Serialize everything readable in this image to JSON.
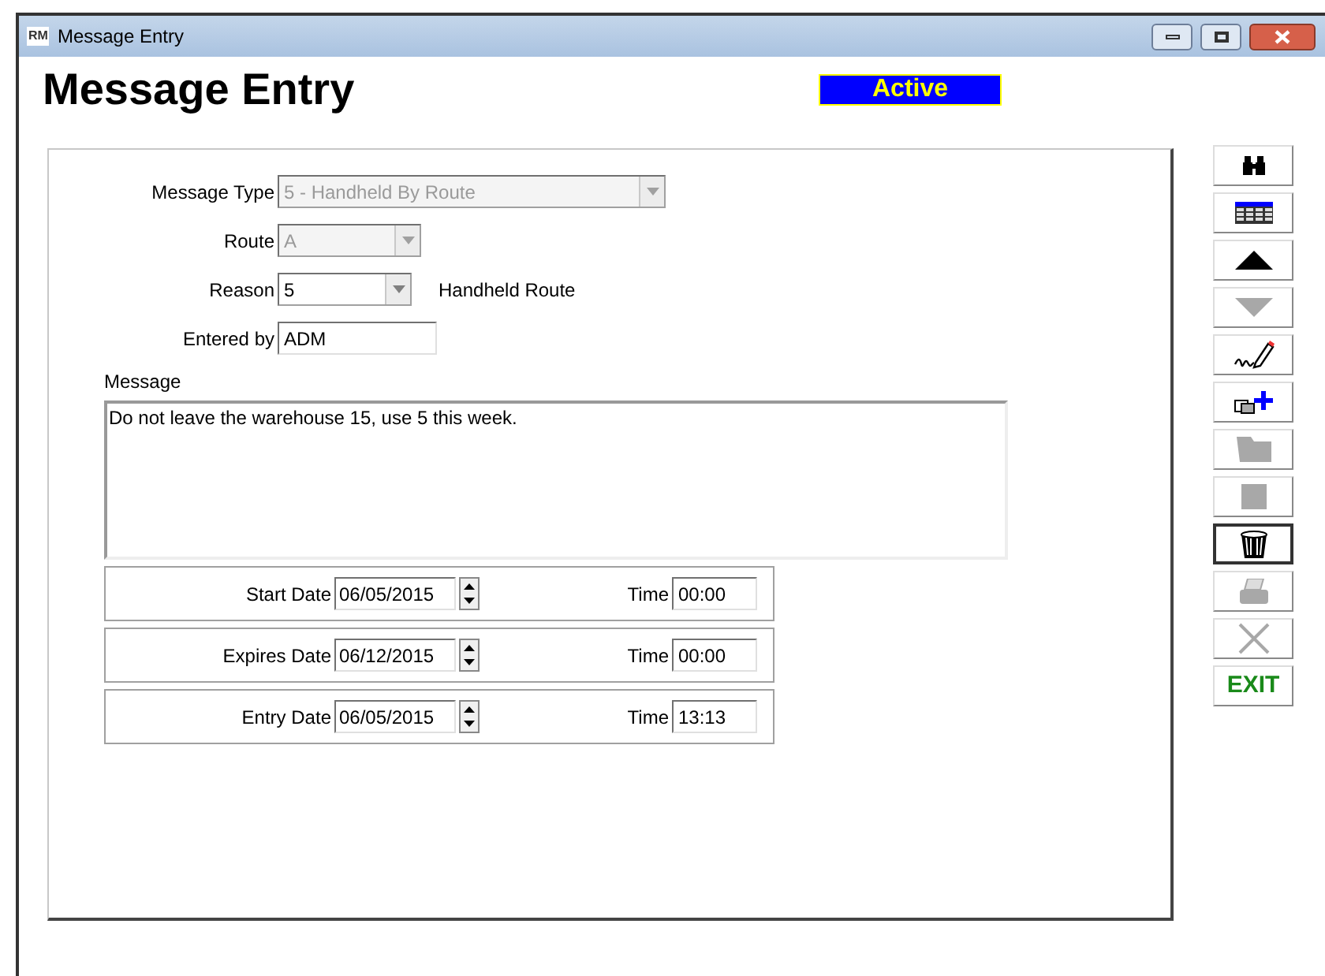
{
  "window": {
    "logo": "RM",
    "title": "Message Entry"
  },
  "heading": "Message Entry",
  "status": "Active",
  "form": {
    "message_type": {
      "label": "Message Type",
      "value": "5 - Handheld By Route",
      "disabled": true
    },
    "route": {
      "label": "Route",
      "value": "A",
      "disabled": true
    },
    "reason": {
      "label": "Reason",
      "value": "5",
      "disabled": false,
      "description": "Handheld Route"
    },
    "entered_by": {
      "label": "Entered by",
      "value": "ADM"
    },
    "message": {
      "label": "Message",
      "value": "Do not leave the warehouse 15, use 5 this week."
    }
  },
  "dates": [
    {
      "label": "Start Date",
      "date": "06/05/2015",
      "time_label": "Time",
      "time": "00:00"
    },
    {
      "label": "Expires Date",
      "date": "06/12/2015",
      "time_label": "Time",
      "time": "00:00"
    },
    {
      "label": "Entry Date",
      "date": "06/05/2015",
      "time_label": "Time",
      "time": "13:13"
    }
  ],
  "toolbar": [
    {
      "kind": "find",
      "disabled": false,
      "selected": false
    },
    {
      "kind": "grid",
      "disabled": false,
      "selected": false
    },
    {
      "kind": "up",
      "disabled": false,
      "selected": false
    },
    {
      "kind": "down",
      "disabled": true,
      "selected": false
    },
    {
      "kind": "sign",
      "disabled": false,
      "selected": false
    },
    {
      "kind": "add",
      "disabled": false,
      "selected": false
    },
    {
      "kind": "folder",
      "disabled": true,
      "selected": false
    },
    {
      "kind": "square",
      "disabled": true,
      "selected": false
    },
    {
      "kind": "trash",
      "disabled": false,
      "selected": true
    },
    {
      "kind": "print",
      "disabled": true,
      "selected": false
    },
    {
      "kind": "cancel",
      "disabled": true,
      "selected": false
    },
    {
      "kind": "exit",
      "disabled": false,
      "selected": false,
      "text": "EXIT"
    }
  ]
}
